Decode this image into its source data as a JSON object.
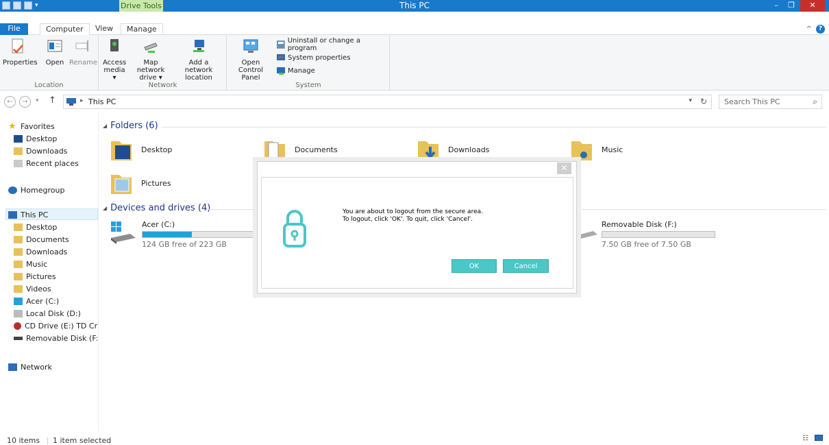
{
  "window": {
    "title": "This PC",
    "contextual_tab": "Drive Tools",
    "minimize": "–",
    "maximize": "❐",
    "close": "✕"
  },
  "tabs": [
    {
      "label": "File"
    },
    {
      "label": "Computer"
    },
    {
      "label": "View"
    },
    {
      "label": "Manage"
    }
  ],
  "ribbon": {
    "location": {
      "label": "Location",
      "properties": "Properties",
      "open": "Open",
      "rename": "Rename"
    },
    "network": {
      "label": "Network",
      "access_media_1": "Access",
      "access_media_2": "media ▾",
      "map_drive_1": "Map network",
      "map_drive_2": "drive ▾",
      "add_location_1": "Add a network",
      "add_location_2": "location"
    },
    "system": {
      "label": "System",
      "control_panel_1": "Open Control",
      "control_panel_2": "Panel",
      "uninstall": "Uninstall or change a program",
      "system_properties": "System properties",
      "manage": "Manage"
    }
  },
  "address": {
    "path": "This PC",
    "search_placeholder": "Search This PC"
  },
  "sidebar": {
    "favorites": "Favorites",
    "favorites_items": [
      "Desktop",
      "Downloads",
      "Recent places"
    ],
    "homegroup": "Homegroup",
    "thispc": "This PC",
    "thispc_items": [
      "Desktop",
      "Documents",
      "Downloads",
      "Music",
      "Pictures",
      "Videos",
      "Acer (C:)",
      "Local Disk (D:)",
      "CD Drive (E:) TD Cry",
      "Removable Disk (F:)"
    ],
    "network": "Network"
  },
  "content": {
    "folders_header": "Folders (6)",
    "folders": [
      "Desktop",
      "Documents",
      "Downloads",
      "Music",
      "Pictures"
    ],
    "devices_header": "Devices and drives (4)",
    "drives": [
      {
        "name": "Acer (C:)",
        "free": "124 GB free of 223 GB",
        "used_fraction": 0.44
      },
      {
        "name": "Removable Disk (F:)",
        "free": "7.50 GB free of 7.50 GB",
        "used_fraction": 0.0
      }
    ]
  },
  "dialog": {
    "message_line1": "You are about to logout from the secure area.",
    "message_line2": "To logout, click 'OK'. To quit, click 'Cancel'.",
    "ok": "OK",
    "cancel": "Cancel",
    "close": "✕",
    "accent": "#4cc6c6"
  },
  "status": {
    "items": "10 items",
    "selected": "1 item selected"
  }
}
